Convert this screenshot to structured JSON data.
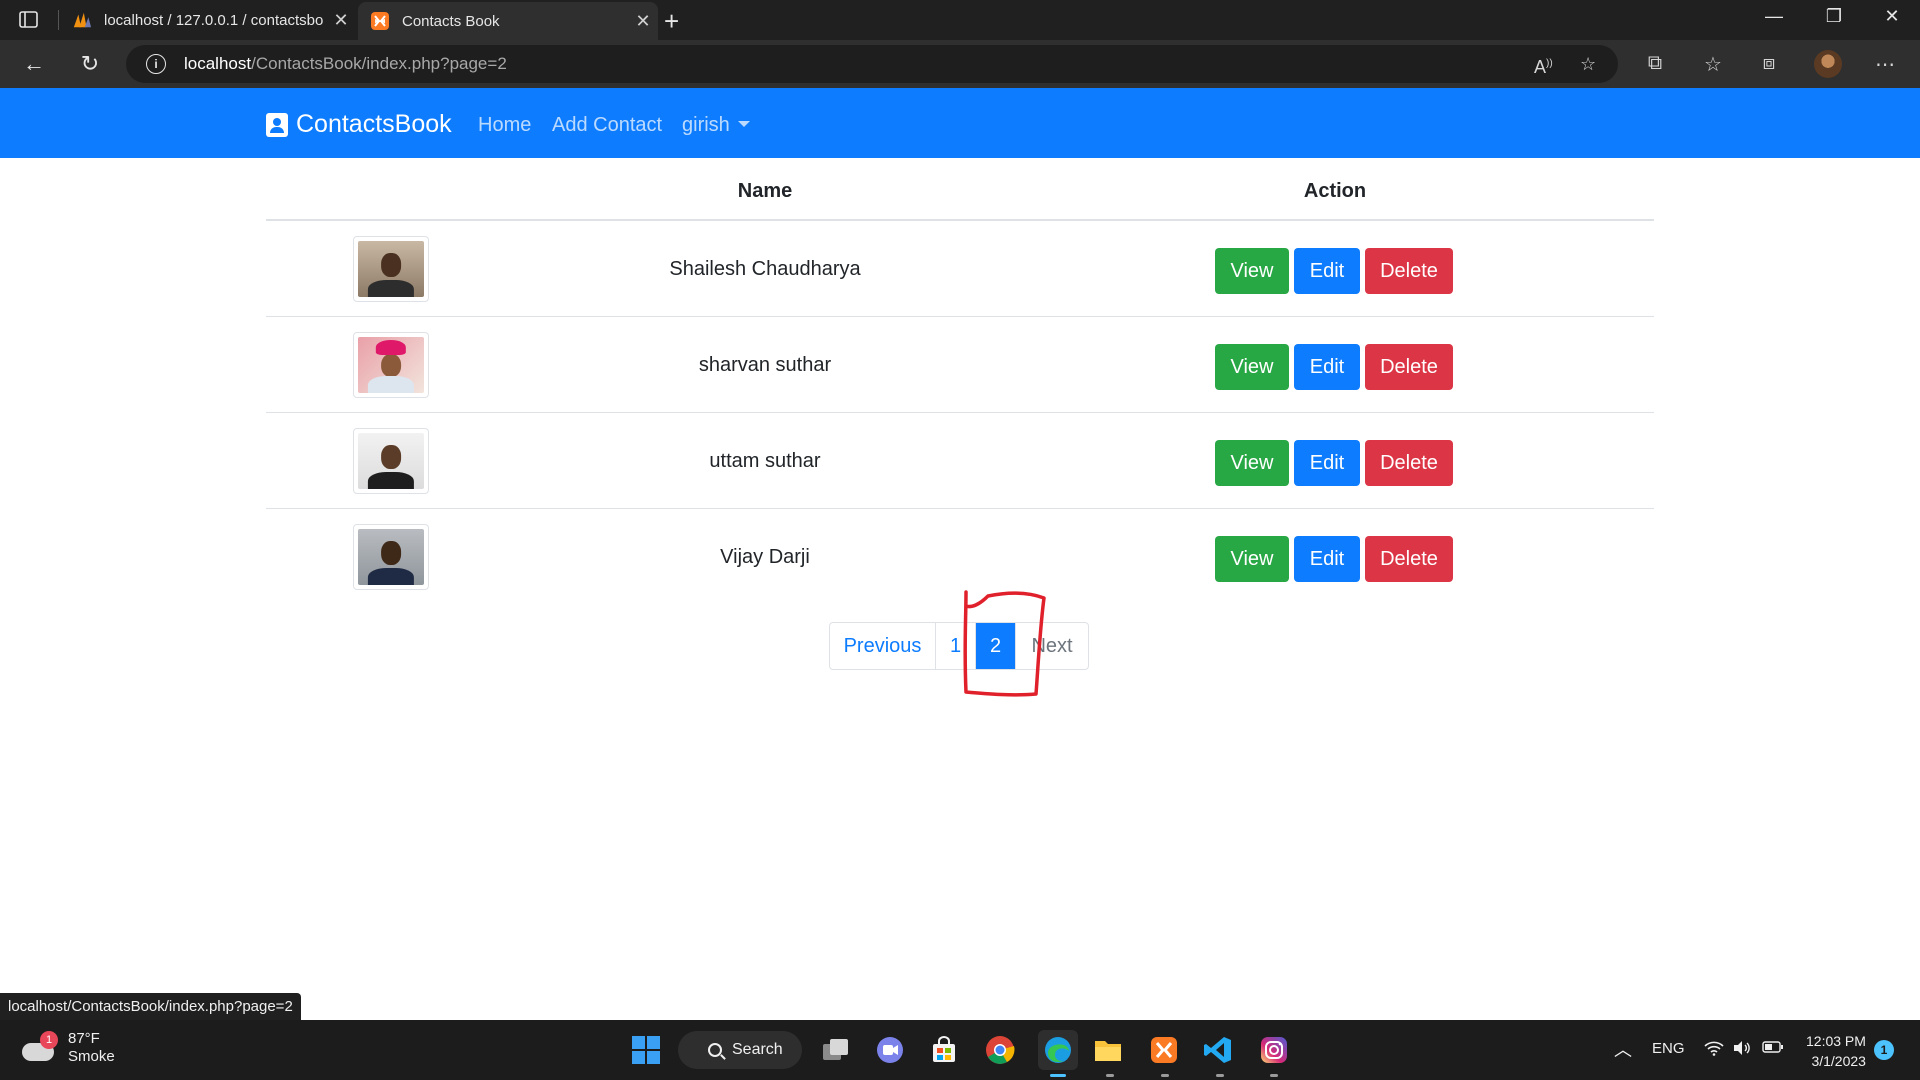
{
  "browser": {
    "tabs": [
      {
        "title": "localhost / 127.0.0.1 / contactsbo",
        "icon": "phpmyadmin-icon",
        "active": false
      },
      {
        "title": "Contacts Book",
        "icon": "xampp-icon",
        "active": true
      }
    ],
    "url_host": "localhost",
    "url_path": "/ContactsBook/index.php?page=2"
  },
  "navbar": {
    "brand": "ContactsBook",
    "links": [
      "Home",
      "Add Contact"
    ],
    "user": "girish"
  },
  "table": {
    "headers": {
      "name": "Name",
      "action": "Action"
    },
    "rows": [
      {
        "name": "Shailesh Chaudharya",
        "view": "View",
        "edit": "Edit",
        "delete": "Delete"
      },
      {
        "name": "sharvan suthar",
        "view": "View",
        "edit": "Edit",
        "delete": "Delete"
      },
      {
        "name": "uttam suthar",
        "view": "View",
        "edit": "Edit",
        "delete": "Delete"
      },
      {
        "name": "Vijay Darji",
        "view": "View",
        "edit": "Edit",
        "delete": "Delete"
      }
    ]
  },
  "pagination": {
    "previous": "Previous",
    "pages": [
      "1",
      "2"
    ],
    "current": "2",
    "next": "Next"
  },
  "status_url": "localhost/ContactsBook/index.php?page=2",
  "taskbar": {
    "weather_temp": "87°F",
    "weather_desc": "Smoke",
    "weather_badge": "1",
    "search_label": "Search",
    "language": "ENG",
    "time": "12:03 PM",
    "date": "3/1/2023",
    "notification_count": "1"
  },
  "colors": {
    "navbar": "#0d7cff",
    "view_button": "#28a745",
    "edit_button": "#0d7cff",
    "delete_button": "#dc3545",
    "annotation": "#e0202a"
  }
}
